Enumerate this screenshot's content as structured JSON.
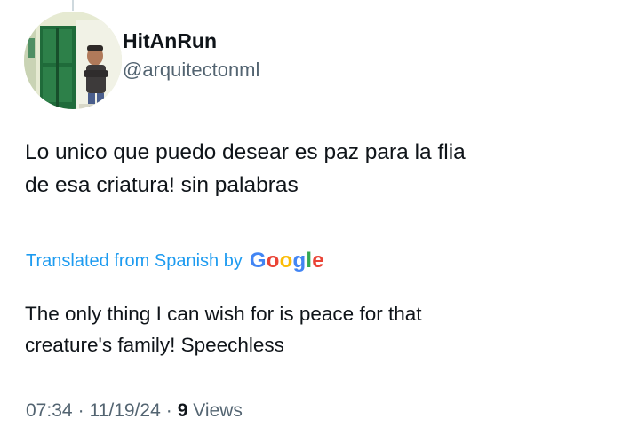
{
  "author": {
    "display_name": "HitAnRun",
    "handle": "@arquitectonml"
  },
  "tweet": {
    "text_lines": [
      "Lo unico que puedo desear es paz para la flia",
      "de esa criatura! sin palabras"
    ]
  },
  "translation": {
    "label": "Translated from Spanish by",
    "provider_letters": [
      "G",
      "o",
      "o",
      "g",
      "l",
      "e"
    ],
    "text_lines": [
      "The only thing I can wish for is peace for that",
      "creature's family! Speechless"
    ]
  },
  "meta": {
    "time": "07:34",
    "date": "11/19/24",
    "separator": "·",
    "views_count": "9",
    "views_label": "Views"
  },
  "colors": {
    "link": "#1d9bf0",
    "secondary_text": "#536471",
    "primary_text": "#0f1419",
    "google_blue": "#4285f4",
    "google_red": "#ea4335",
    "google_yellow": "#fbbc05",
    "google_green": "#34a853"
  }
}
